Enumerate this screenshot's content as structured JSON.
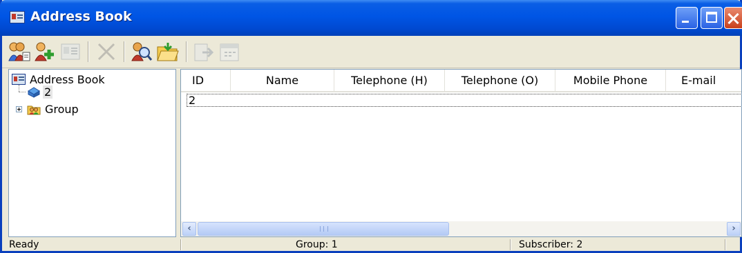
{
  "window": {
    "title": "Address Book",
    "controls": [
      "minimize-icon",
      "maximize-icon",
      "close-icon"
    ]
  },
  "toolbar": {
    "buttons": [
      {
        "icon": "add-contact-icon",
        "enabled": true
      },
      {
        "icon": "add-group-icon",
        "enabled": true
      },
      {
        "icon": "properties-icon",
        "enabled": false
      },
      {
        "icon": "delete-icon",
        "enabled": false
      },
      {
        "icon": "find-people-icon",
        "enabled": true
      },
      {
        "icon": "open-folder-icon",
        "enabled": true
      },
      {
        "icon": "export-icon",
        "enabled": false
      },
      {
        "icon": "calendar-icon",
        "enabled": false
      }
    ]
  },
  "tree": {
    "root_label": "Address Book",
    "items": [
      {
        "label": "2",
        "icon": "contact-folder-icon"
      },
      {
        "label": "Group",
        "icon": "group-icon"
      }
    ]
  },
  "list": {
    "columns": [
      "ID",
      "Name",
      "Telephone (H)",
      "Telephone (O)",
      "Mobile Phone",
      "E-mail"
    ],
    "rows": [
      {
        "id": "2"
      }
    ]
  },
  "statusbar": {
    "status": "Ready",
    "group": "Group: 1",
    "subscriber": "Subscriber: 2"
  },
  "colors": {
    "titlebar": "#0055e5",
    "window_bg": "#ece9d8",
    "border": "#7f9db9"
  }
}
